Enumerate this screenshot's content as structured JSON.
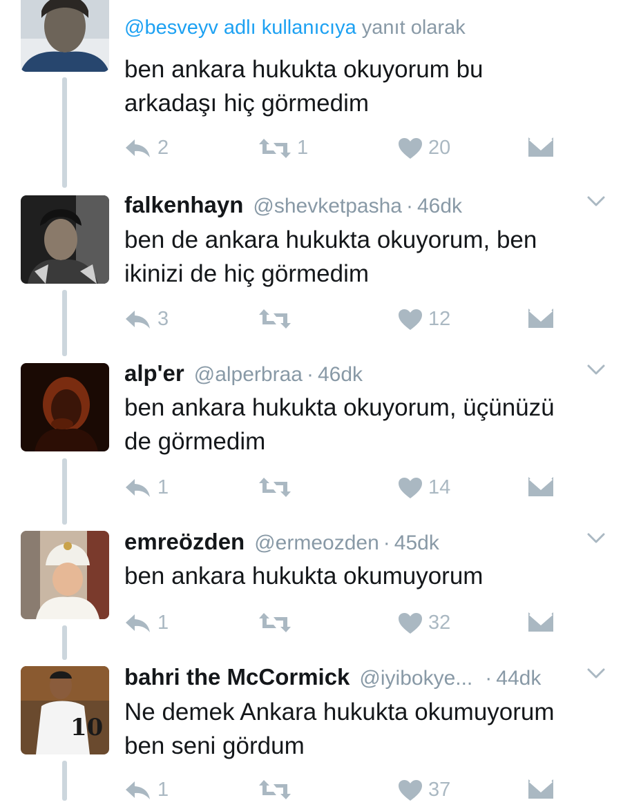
{
  "top_tweet": {
    "reply_link": "@besveyv adlı kullanıcıya",
    "reply_suffix": "yanıt olarak",
    "text_line1": "ben ankara hukukta okuyorum bu",
    "text_line2": "arkadaşı hiç görmedim",
    "replies": "2",
    "retweets": "1",
    "likes": "20"
  },
  "tweets": [
    {
      "name": "falkenhayn",
      "handle": "@shevketpasha",
      "dot": "·",
      "time": "46dk",
      "text_line1": "ben de ankara hukukta okuyorum, ben",
      "text_line2": "ikinizi de hiç görmedim",
      "replies": "3",
      "retweets": "",
      "likes": "12"
    },
    {
      "name": "alp'er",
      "handle": "@alperbraa",
      "dot": "·",
      "time": "46dk",
      "text_line1": "ben ankara hukukta okuyorum, üçünüzü",
      "text_line2": "de görmedim",
      "replies": "1",
      "retweets": "",
      "likes": "14"
    },
    {
      "name": "emreözden",
      "handle": "@ermeozden",
      "dot": "·",
      "time": "45dk",
      "text_line1": "ben ankara hukukta okumuyorum",
      "text_line2": "",
      "replies": "1",
      "retweets": "",
      "likes": "32"
    },
    {
      "name": "bahri the McCormick",
      "handle": "@iyibokye...",
      "dot": "·",
      "time": "44dk",
      "text_line1": "Ne demek Ankara hukukta okumuyorum",
      "text_line2": "ben seni gördum",
      "replies": "1",
      "retweets": "",
      "likes": "37"
    }
  ],
  "icons": {
    "reply": "reply-icon",
    "retweet": "retweet-icon",
    "like": "heart-icon",
    "dm": "envelope-icon",
    "more": "chevron-down-icon"
  },
  "colors": {
    "text": "#14171a",
    "muted": "#8899a6",
    "link": "#1da1f2",
    "action": "#aab8c2",
    "thread_line": "#ccd6dd"
  }
}
